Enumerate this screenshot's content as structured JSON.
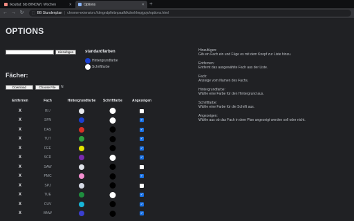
{
  "browser": {
    "tabs": [
      {
        "title": "Ikoultat: bib 8/INOW | Wochen",
        "active": false,
        "favicon_color": "#f28b82"
      },
      {
        "title": "Options",
        "active": true,
        "favicon_color": "#8ab4f8"
      }
    ],
    "new_tab_icon": "plus-icon",
    "address": {
      "origin": "BB Stundenplan",
      "path": "chrome-extension://dmgndpfiebnpaafklkdnnhlmpjgojo/options.html"
    }
  },
  "page": {
    "title": "OPTIONS",
    "add": {
      "input_value": "",
      "button_label": "Hinzufügen"
    },
    "standard": {
      "title": "standardfarben",
      "background_label": "Hintergrundfarbe",
      "background_color": "#1a3fd1",
      "font_label": "Schriftfarbe",
      "font_color": "#ffffff"
    },
    "subjects_title": "Fächer:",
    "download_label": "Download",
    "choose_file_label": "Choose File",
    "no_file_text": "N",
    "table": {
      "headers": {
        "remove": "Entfernen",
        "subject": "Fach",
        "background": "Hintergrundfarbe",
        "font": "Schriftfarbe",
        "show": "Angezeigen"
      },
      "rows": [
        {
          "remove": "X",
          "name": "RI /",
          "bg": "#e8eaed",
          "fg": "#ffffff",
          "show": false
        },
        {
          "remove": "X",
          "name": "SFN",
          "bg": "#1a3fd1",
          "fg": "#ffffff",
          "show": true
        },
        {
          "remove": "X",
          "name": "DAS",
          "bg": "#d93025",
          "fg": "#000000",
          "show": true
        },
        {
          "remove": "X",
          "name": "TUT",
          "bg": "#2e9e3e",
          "fg": "#000000",
          "show": true
        },
        {
          "remove": "X",
          "name": "FEE",
          "bg": "#e6e600",
          "fg": "#000000",
          "show": true
        },
        {
          "remove": "X",
          "name": "SCD",
          "bg": "#7b2ab0",
          "fg": "#ffffff",
          "show": true
        },
        {
          "remove": "X",
          "name": "SAW",
          "bg": "#e0e3ea",
          "fg": "#000000",
          "show": false
        },
        {
          "remove": "X",
          "name": "PMC",
          "bg": "#f48fd0",
          "fg": "#000000",
          "show": true
        },
        {
          "remove": "X",
          "name": "SPJ",
          "bg": "#d7dbe6",
          "fg": "#000000",
          "show": false
        },
        {
          "remove": "X",
          "name": "TUE",
          "bg": "#1e8e3e",
          "fg": "#ffffff",
          "show": true
        },
        {
          "remove": "X",
          "name": "CUV",
          "bg": "#17b7d9",
          "fg": "#000000",
          "show": true
        },
        {
          "remove": "X",
          "name": "BNW",
          "bg": "#3a3fd1",
          "fg": "#000000",
          "show": true
        }
      ]
    },
    "help": [
      {
        "label": "Hinzufügen:",
        "desc": "Gib ein Fach ein und Füge es mit dem Knopf zur Liste hinzu."
      },
      {
        "label": "Entfernen:",
        "desc": "Entfernt das ausgewählte Fach aus der Liste."
      },
      {
        "label": "Fach:",
        "desc": "Anzeige vom Namen des Fachs."
      },
      {
        "label": "Hintergrundfarbe:",
        "desc": "Wähle eine Farbe für den Hintergrund aus."
      },
      {
        "label": "Schriftfarbe:",
        "desc": "Wähle eine Farbe für die Schrift aus."
      },
      {
        "label": "Angezeigen:",
        "desc": "Wähle aus ob das Fach in dem Plan angezeigt werden soll oder nicht."
      }
    ]
  }
}
